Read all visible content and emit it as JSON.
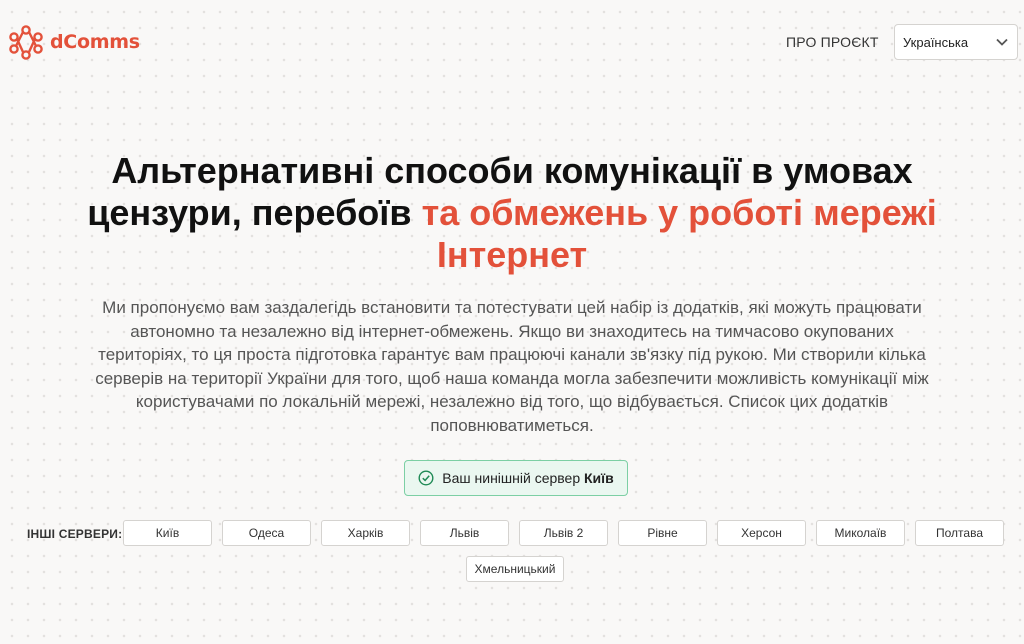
{
  "header": {
    "logo_text": "dComms",
    "about_link": "ПРО ПРОЄКТ",
    "language": {
      "selected": "Українська"
    }
  },
  "hero": {
    "title_part1": "Альтернативні способи комунікації в умовах цензури, перебоїв ",
    "title_accent": "та обмежень у роботі мережі Інтернет",
    "description": "Ми пропонуємо вам заздалегідь встановити та потестувати цей набір із додатків, які можуть працювати автономно та незалежно від інтернет-обмежень. Якщо ви знаходитесь на тимчасово окупованих територіях, то ця проста підготовка гарантує вам працюючі канали зв'язку під рукою. Ми створили кілька серверів на території України для того, щоб наша команда могла забезпечити можливість комунікації між користувачами по локальній мережі, незалежно від того, що відбувається. Список цих додатків поповнюватиметься."
  },
  "current_server": {
    "prefix": "Ваш нинішній сервер",
    "city": "Київ"
  },
  "servers": {
    "label": "ІНШІ СЕРВЕРИ:",
    "items": [
      "Київ",
      "Одеса",
      "Харків",
      "Львів",
      "Львів 2",
      "Рівне",
      "Херсон",
      "Миколаїв",
      "Полтава",
      "Хмельницький"
    ]
  },
  "colors": {
    "accent": "#e3513a",
    "success_bg": "#eaf7f0",
    "success_border": "#7ccfa4",
    "success_icon": "#1f8a55"
  },
  "icons": {
    "logo": "network-nodes-icon",
    "language": "chevron-down-icon",
    "current_server": "check-circle-icon"
  }
}
